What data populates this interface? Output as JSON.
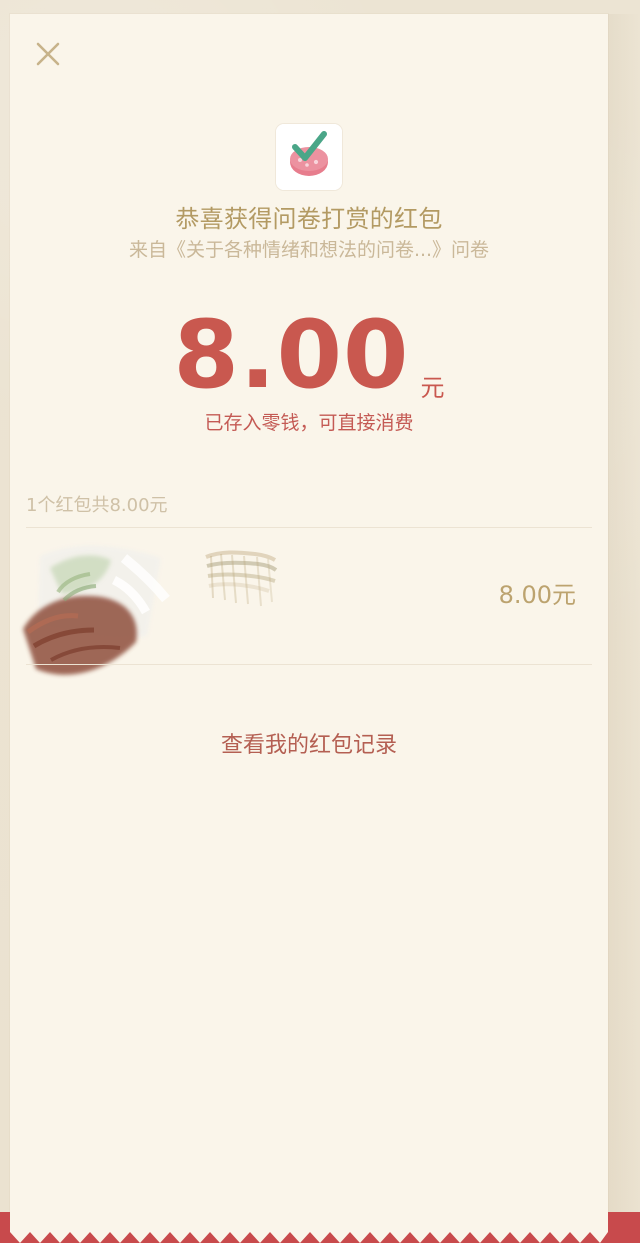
{
  "dialog": {
    "title": "恭喜获得问卷打赏的红包",
    "subtitle": "来自《关于各种情绪和想法的问卷...》问卷",
    "amount": "8.00",
    "unit": "元",
    "stored_note": "已存入零钱，可直接消费",
    "packet_count": "1个红包共8.00元",
    "history_link": "查看我的红包记录"
  },
  "record": {
    "amount": "8.00元"
  },
  "icons": {
    "close": "close-icon",
    "app": "questionnaire-app-icon",
    "avatar": "avatar"
  },
  "colors": {
    "background": "#ece4d3",
    "sheet": "#faf5ea",
    "gold_text": "#b39a63",
    "muted_gold": "#cab899",
    "red_text": "#c9584f",
    "link_red": "#b45f52"
  }
}
